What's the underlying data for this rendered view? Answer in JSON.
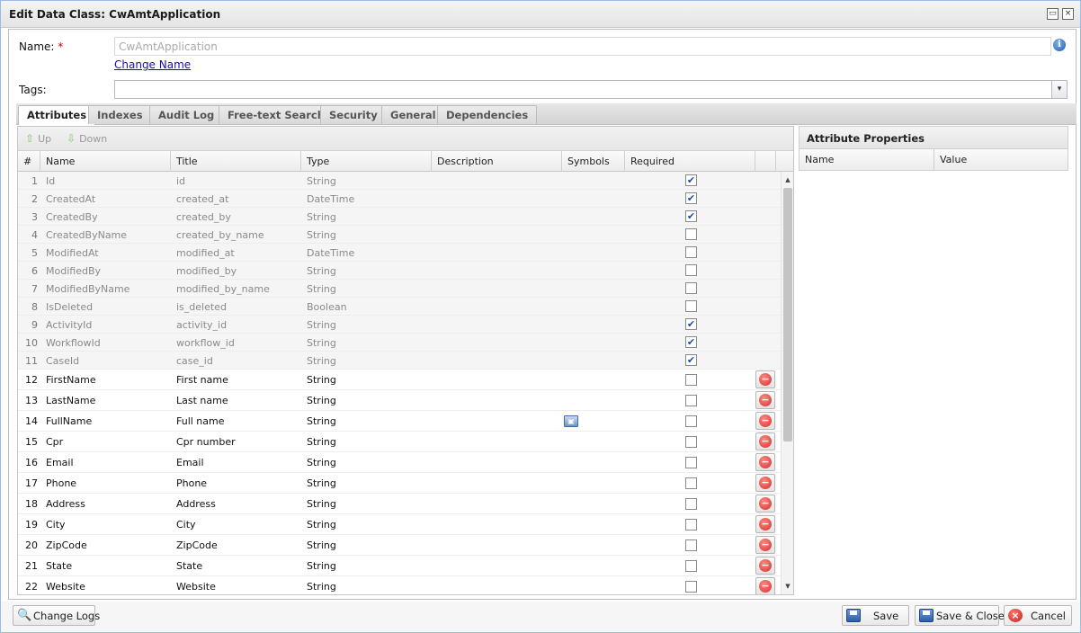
{
  "window": {
    "title": "Edit Data Class: CwAmtApplication",
    "restore_icon": "▭",
    "close_icon": "×"
  },
  "form": {
    "name_label": "Name:",
    "required_mark": "*",
    "name_value": "CwAmtApplication",
    "info_icon": "i",
    "change_name_link": "Change Name",
    "tags_label": "Tags:",
    "tags_value": "",
    "dropdown_icon": "▾"
  },
  "tabs": [
    {
      "label": "Attributes",
      "active": true
    },
    {
      "label": "Indexes",
      "active": false
    },
    {
      "label": "Audit Log",
      "active": false
    },
    {
      "label": "Free-text Search",
      "active": false
    },
    {
      "label": "Security",
      "active": false
    },
    {
      "label": "General",
      "active": false
    },
    {
      "label": "Dependencies",
      "active": false
    }
  ],
  "grid": {
    "toolbar": {
      "up_label": "Up",
      "down_label": "Down",
      "up_arrow": "⇧",
      "down_arrow": "⇩"
    },
    "columns": [
      "#",
      "Name",
      "Title",
      "Type",
      "Description",
      "Symbols",
      "Required"
    ],
    "rows": [
      {
        "n": "1",
        "name": "Id",
        "title": "id",
        "type": "String",
        "required": true,
        "inherited": true
      },
      {
        "n": "2",
        "name": "CreatedAt",
        "title": "created_at",
        "type": "DateTime",
        "required": true,
        "inherited": true
      },
      {
        "n": "3",
        "name": "CreatedBy",
        "title": "created_by",
        "type": "String",
        "required": true,
        "inherited": true
      },
      {
        "n": "4",
        "name": "CreatedByName",
        "title": "created_by_name",
        "type": "String",
        "required": false,
        "inherited": true
      },
      {
        "n": "5",
        "name": "ModifiedAt",
        "title": "modified_at",
        "type": "DateTime",
        "required": false,
        "inherited": true
      },
      {
        "n": "6",
        "name": "ModifiedBy",
        "title": "modified_by",
        "type": "String",
        "required": false,
        "inherited": true
      },
      {
        "n": "7",
        "name": "ModifiedByName",
        "title": "modified_by_name",
        "type": "String",
        "required": false,
        "inherited": true
      },
      {
        "n": "8",
        "name": "IsDeleted",
        "title": "is_deleted",
        "type": "Boolean",
        "required": false,
        "inherited": true
      },
      {
        "n": "9",
        "name": "ActivityId",
        "title": "activity_id",
        "type": "String",
        "required": true,
        "inherited": true
      },
      {
        "n": "10",
        "name": "WorkflowId",
        "title": "workflow_id",
        "type": "String",
        "required": true,
        "inherited": true
      },
      {
        "n": "11",
        "name": "CaseId",
        "title": "case_id",
        "type": "String",
        "required": true,
        "inherited": true
      },
      {
        "n": "12",
        "name": "FirstName",
        "title": "First name",
        "type": "String",
        "required": false,
        "inherited": false
      },
      {
        "n": "13",
        "name": "LastName",
        "title": "Last name",
        "type": "String",
        "required": false,
        "inherited": false
      },
      {
        "n": "14",
        "name": "FullName",
        "title": "Full name",
        "type": "String",
        "required": false,
        "inherited": false,
        "symbol": "computed-icon"
      },
      {
        "n": "15",
        "name": "Cpr",
        "title": "Cpr number",
        "type": "String",
        "required": false,
        "inherited": false
      },
      {
        "n": "16",
        "name": "Email",
        "title": "Email",
        "type": "String",
        "required": false,
        "inherited": false
      },
      {
        "n": "17",
        "name": "Phone",
        "title": "Phone",
        "type": "String",
        "required": false,
        "inherited": false
      },
      {
        "n": "18",
        "name": "Address",
        "title": "Address",
        "type": "String",
        "required": false,
        "inherited": false
      },
      {
        "n": "19",
        "name": "City",
        "title": "City",
        "type": "String",
        "required": false,
        "inherited": false
      },
      {
        "n": "20",
        "name": "ZipCode",
        "title": "ZipCode",
        "type": "String",
        "required": false,
        "inherited": false
      },
      {
        "n": "21",
        "name": "State",
        "title": "State",
        "type": "String",
        "required": false,
        "inherited": false
      },
      {
        "n": "22",
        "name": "Website",
        "title": "Website",
        "type": "String",
        "required": false,
        "inherited": false
      }
    ]
  },
  "properties": {
    "title": "Attribute Properties",
    "columns": [
      "Name",
      "Value"
    ]
  },
  "footer": {
    "change_logs_label": "Change Logs",
    "save_label": "Save",
    "save_close_label": "Save & Close",
    "cancel_label": "Cancel"
  },
  "icons": {
    "delete": "−",
    "check": "✔"
  }
}
